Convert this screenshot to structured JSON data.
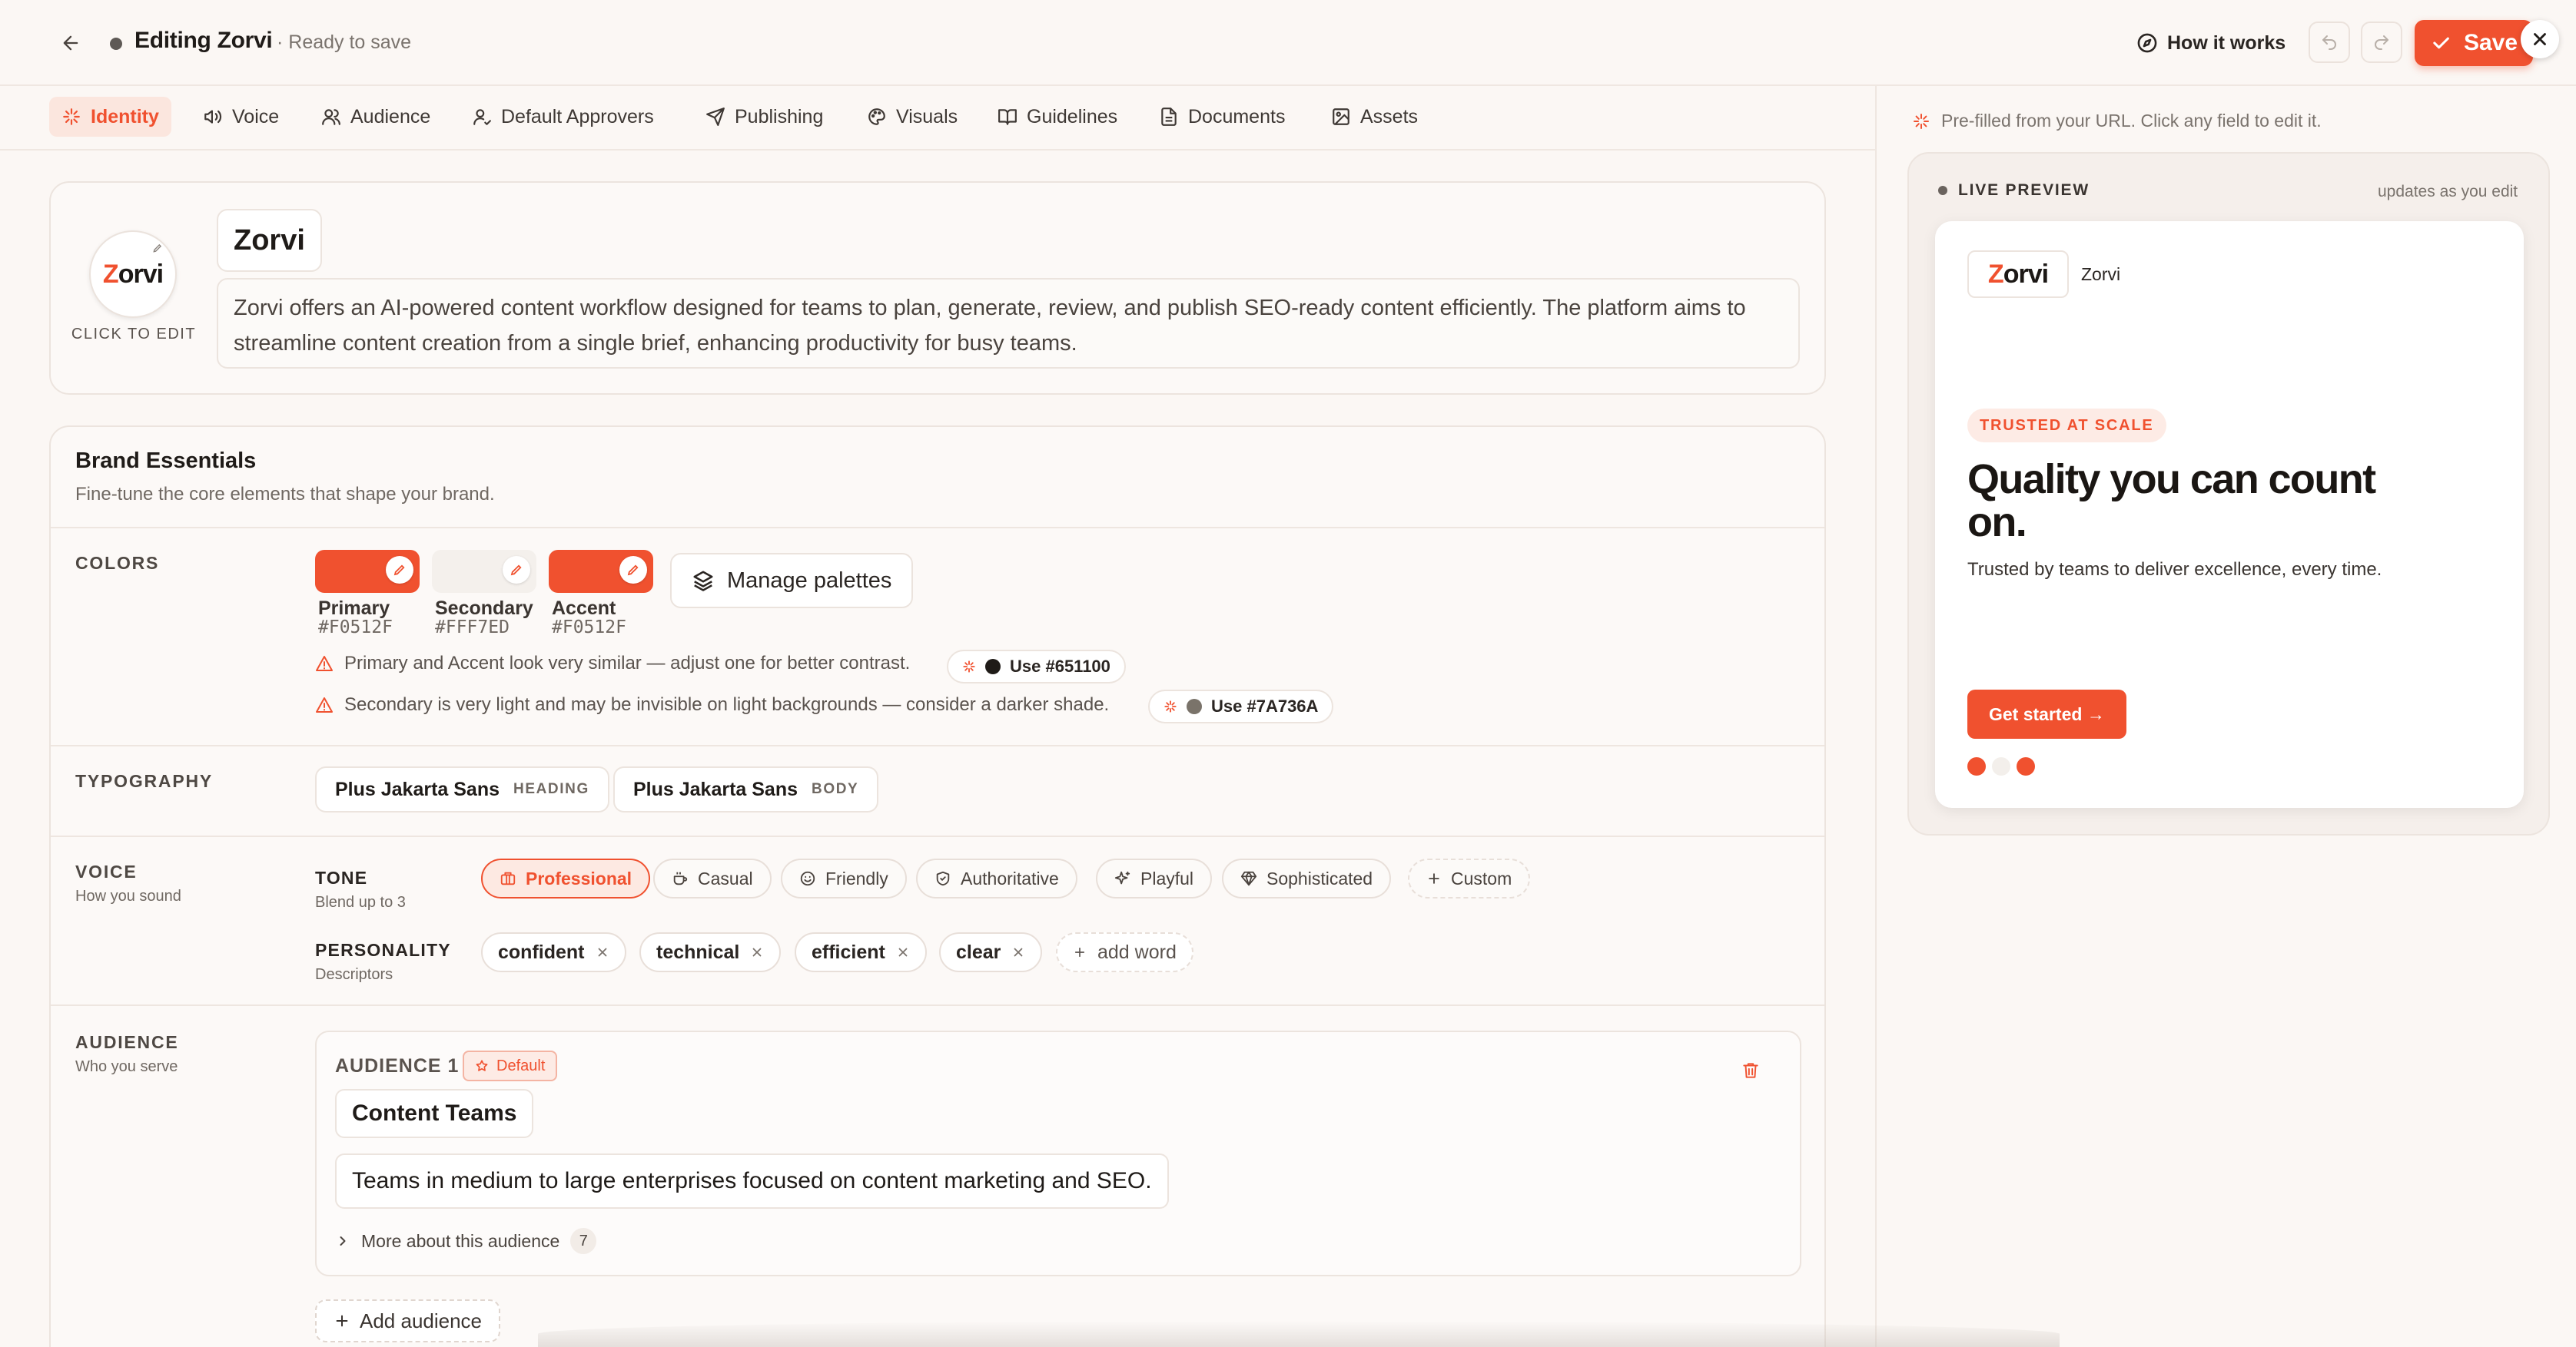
{
  "header": {
    "title": "Editing Zorvi",
    "status": "· Ready to save",
    "how_it_works": "How it works",
    "save_label": "Save"
  },
  "tabs": [
    {
      "label": "Identity",
      "icon": "sparkle-icon",
      "active": true
    },
    {
      "label": "Voice",
      "icon": "speaker-icon"
    },
    {
      "label": "Audience",
      "icon": "users-icon"
    },
    {
      "label": "Default Approvers",
      "icon": "user-check-icon"
    },
    {
      "label": "Publishing",
      "icon": "send-icon"
    },
    {
      "label": "Visuals",
      "icon": "palette-icon"
    },
    {
      "label": "Guidelines",
      "icon": "book-icon"
    },
    {
      "label": "Documents",
      "icon": "document-icon"
    },
    {
      "label": "Assets",
      "icon": "image-icon"
    }
  ],
  "identity": {
    "logo_text_accent": "Z",
    "logo_text_rest": "orvi",
    "click_to_edit": "CLICK TO EDIT",
    "name": "Zorvi",
    "description": "Zorvi offers an AI-powered content workflow designed for teams to plan, generate, review, and publish SEO-ready content efficiently. The platform aims to streamline content creation from a single brief, enhancing productivity for busy teams."
  },
  "essentials": {
    "title": "Brand Essentials",
    "subtitle": "Fine-tune the core elements that shape your brand.",
    "colors": {
      "label": "COLORS",
      "swatches": [
        {
          "name": "Primary",
          "hex": "#F0512F"
        },
        {
          "name": "Secondary",
          "hex": "#FFF7ED"
        },
        {
          "name": "Accent",
          "hex": "#F0512F"
        }
      ],
      "manage_palettes": "Manage palettes",
      "warnings": [
        {
          "text": "Primary and Accent look very similar — adjust one for better contrast.",
          "suggest_label": "Use #651100",
          "suggest_color": "#1f1b18"
        },
        {
          "text": "Secondary is very light and may be invisible on light backgrounds — consider a darker shade.",
          "suggest_label": "Use #7A736A",
          "suggest_color": "#7a736a"
        }
      ]
    },
    "typography": {
      "label": "TYPOGRAPHY",
      "fonts": [
        {
          "name": "Plus Jakarta Sans",
          "role": "HEADING"
        },
        {
          "name": "Plus Jakarta Sans",
          "role": "BODY"
        }
      ]
    },
    "voice": {
      "label": "VOICE",
      "sub": "How you sound",
      "tone_label": "TONE",
      "tone_sub": "Blend up to 3",
      "tones": [
        {
          "label": "Professional",
          "icon": "briefcase-icon",
          "selected": true
        },
        {
          "label": "Casual",
          "icon": "coffee-icon"
        },
        {
          "label": "Friendly",
          "icon": "smile-icon"
        },
        {
          "label": "Authoritative",
          "icon": "shield-icon"
        },
        {
          "label": "Playful",
          "icon": "sparkle-icon"
        },
        {
          "label": "Sophisticated",
          "icon": "gem-icon"
        },
        {
          "label": "Custom",
          "icon": "plus-icon"
        }
      ],
      "personality_label": "PERSONALITY",
      "personality_sub": "Descriptors",
      "words": [
        "confident",
        "technical",
        "efficient",
        "clear"
      ],
      "add_word": "add word"
    },
    "audience": {
      "label": "AUDIENCE",
      "sub": "Who you serve",
      "card_label": "AUDIENCE 1",
      "default_badge": "Default",
      "name": "Content Teams",
      "description": "Teams in medium to large enterprises focused on content marketing and SEO.",
      "more_label": "More about this audience",
      "more_count": "7",
      "add_label": "Add audience"
    }
  },
  "preview": {
    "prefilled_note": "Pre-filled from your URL. Click any field to edit it.",
    "live_label": "LIVE PREVIEW",
    "updates_note": "updates as you edit",
    "brand_name": "Zorvi",
    "badge": "TRUSTED AT SCALE",
    "headline": "Quality you can count on.",
    "subline": "Trusted by teams to deliver excellence, every time.",
    "cta": "Get started →",
    "dots": [
      "#F0512F",
      "#FFF7ED",
      "#F0512F"
    ]
  },
  "colors": {
    "accent": "#F0512F"
  }
}
